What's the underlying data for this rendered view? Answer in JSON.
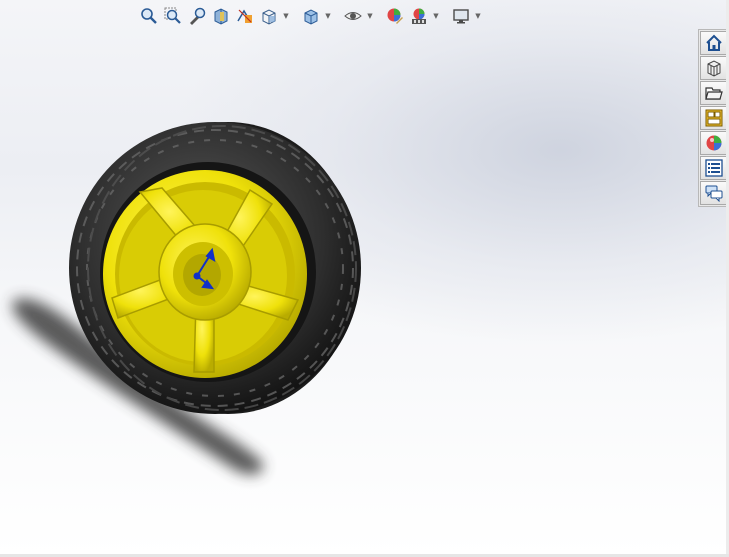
{
  "toolbar": {
    "buttons": [
      {
        "name": "zoom-to-fit",
        "icon": "zoom-to-fit-icon"
      },
      {
        "name": "zoom-to-area",
        "icon": "zoom-to-area-icon"
      },
      {
        "name": "previous-view",
        "icon": "previous-view-icon"
      },
      {
        "name": "section-view",
        "icon": "section-view-icon"
      },
      {
        "name": "dynamic-annotation",
        "icon": "dynamic-annotation-icon"
      },
      {
        "name": "view-orientation",
        "icon": "view-orientation-icon",
        "dropdown": true
      },
      {
        "name": "display-style",
        "icon": "display-style-icon",
        "dropdown": true
      },
      {
        "name": "hide-show-items",
        "icon": "hide-show-icon",
        "dropdown": true
      },
      {
        "name": "edit-appearance",
        "icon": "edit-appearance-icon"
      },
      {
        "name": "apply-scene",
        "icon": "apply-scene-icon",
        "dropdown": true
      },
      {
        "name": "view-settings",
        "icon": "view-settings-icon",
        "dropdown": true
      }
    ]
  },
  "task_pane": {
    "tabs": [
      {
        "name": "home",
        "icon": "home-icon"
      },
      {
        "name": "design-library",
        "icon": "design-library-icon"
      },
      {
        "name": "file-explorer",
        "icon": "folder-icon"
      },
      {
        "name": "view-palette",
        "icon": "view-palette-icon"
      },
      {
        "name": "appearances",
        "icon": "appearances-icon"
      },
      {
        "name": "custom-properties",
        "icon": "custom-properties-icon"
      },
      {
        "name": "forum",
        "icon": "forum-icon"
      }
    ]
  },
  "colors": {
    "rim": "#efe10a",
    "rim_shade": "#b9ac00",
    "tire": "#2b2b2b",
    "tire_tread": "#4a4a4a",
    "axis_triad": "#1030c8",
    "shadow": "#3c3c3c"
  }
}
